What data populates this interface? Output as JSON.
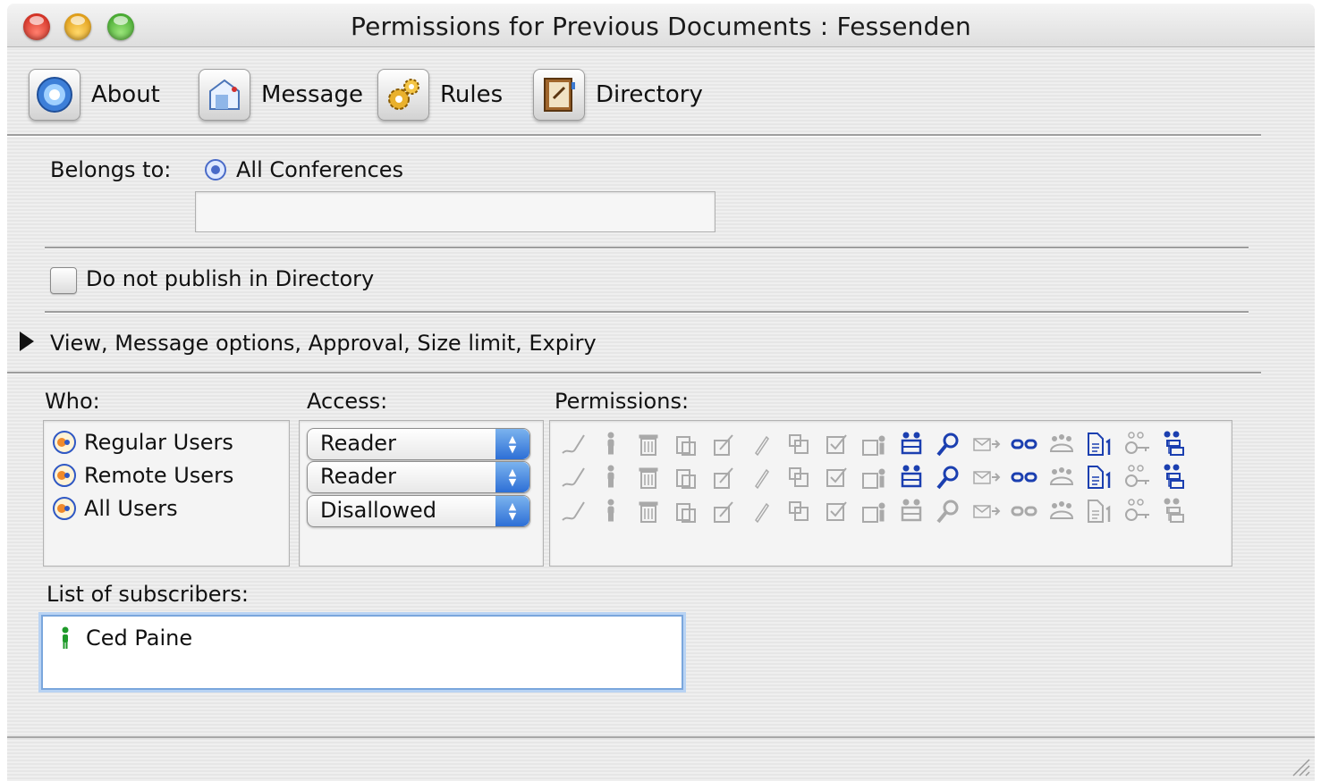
{
  "window": {
    "title": "Permissions for Previous Documents : Fessenden"
  },
  "toolbar": {
    "buttons": [
      {
        "label": "About",
        "icon": "about-icon"
      },
      {
        "label": "Message",
        "icon": "message-icon"
      },
      {
        "label": "Rules",
        "icon": "rules-gear-icon"
      },
      {
        "label": "Directory",
        "icon": "directory-book-icon"
      }
    ]
  },
  "belongs": {
    "label": "Belongs to:",
    "value": "All Conferences",
    "field_value": ""
  },
  "publish": {
    "label": "Do not publish in Directory",
    "checked": false
  },
  "disclosure": {
    "label": "View, Message options, Approval, Size limit, Expiry",
    "expanded": false
  },
  "who": {
    "label": "Who:",
    "items": [
      "Regular Users",
      "Remote Users",
      "All Users"
    ]
  },
  "access": {
    "label": "Access:",
    "values": [
      "Reader",
      "Reader",
      "Disallowed"
    ]
  },
  "permissions": {
    "label": "Permissions:",
    "icons": [
      "sign-icon",
      "person-icon",
      "trash-icon",
      "copy-icon",
      "edit-icon",
      "pencil-icon",
      "duplicate-icon",
      "checkbox-icon",
      "delete-people-icon",
      "group-icon",
      "search-icon",
      "forward-mail-icon",
      "link-icon",
      "members-icon",
      "document-number-icon",
      "keys-icon",
      "hierarchy-icon"
    ],
    "rows": [
      {
        "active": [
          false,
          false,
          false,
          false,
          false,
          false,
          false,
          false,
          false,
          true,
          true,
          false,
          true,
          false,
          true,
          false,
          true
        ]
      },
      {
        "active": [
          false,
          false,
          false,
          false,
          false,
          false,
          false,
          false,
          false,
          true,
          true,
          false,
          true,
          false,
          true,
          false,
          true
        ]
      },
      {
        "active": [
          false,
          false,
          false,
          false,
          false,
          false,
          false,
          false,
          false,
          false,
          false,
          false,
          false,
          false,
          false,
          false,
          false
        ]
      }
    ]
  },
  "subscribers": {
    "label": "List of subscribers:",
    "items": [
      "Ced Paine"
    ]
  },
  "colors": {
    "accent": "#2d6fd6",
    "active_icon": "#1b3fb0",
    "inactive_icon": "#a9a9a9"
  }
}
